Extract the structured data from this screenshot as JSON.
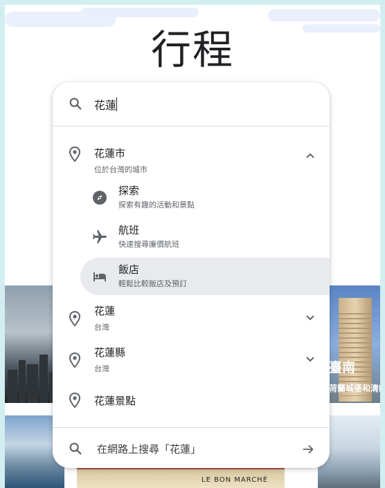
{
  "page": {
    "title": "行程"
  },
  "search": {
    "value": "花蓮",
    "placeholder": ""
  },
  "suggestions": [
    {
      "title": "花蓮市",
      "subtitle": "位於台灣的城市",
      "icon": "location-pin-icon",
      "expanded": true,
      "children": [
        {
          "title": "探索",
          "subtitle": "探索有趣的活動和景點",
          "icon": "compass-icon"
        },
        {
          "title": "航班",
          "subtitle": "快速搜尋廉價航班",
          "icon": "airplane-icon"
        },
        {
          "title": "飯店",
          "subtitle": "輕鬆比較飯店及預訂",
          "icon": "hotel-bed-icon",
          "active": true
        }
      ]
    },
    {
      "title": "花蓮",
      "subtitle": "台灣",
      "icon": "location-pin-icon",
      "expanded": false
    },
    {
      "title": "花蓮縣",
      "subtitle": "台灣",
      "icon": "location-pin-icon",
      "expanded": false
    },
    {
      "title": "花蓮景點",
      "subtitle": "",
      "icon": "location-pin-icon"
    }
  ],
  "web_search": {
    "label": "在網路上搜尋「花蓮」"
  },
  "background_cards": {
    "right": {
      "title": "臺南",
      "subtitle": "荷蘭城堡和清幽"
    },
    "mid_bottom": {
      "sign": "LE BON MARCHÉ"
    }
  },
  "colors": {
    "accent_bg": "#d3eef0",
    "active_row": "#e8eaed",
    "icon": "#5f6368"
  }
}
